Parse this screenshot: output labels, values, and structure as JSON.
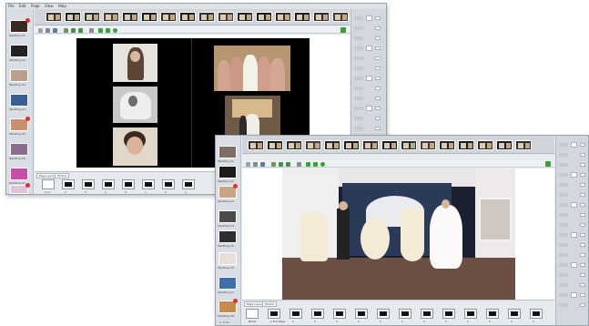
{
  "window1": {
    "menu": [
      "File",
      "Edit",
      "Page",
      "View",
      "Help"
    ],
    "sidebar_captions": [
      "Wedding 01",
      "Wedding 02",
      "Wedding 03",
      "Wedding 04",
      "Wedding 05",
      "Wedding 06",
      "Wedding 07",
      "Wedding 08"
    ],
    "template_count": 16,
    "tabs": [
      "Page Layouts",
      "Photos"
    ],
    "layout_captions": [
      "1+1",
      "2",
      "3",
      "1",
      "4",
      "1",
      "2",
      "1"
    ]
  },
  "window2": {
    "sidebar_captions": [
      "Wedding 01",
      "Wedding 02",
      "Wedding 03",
      "Wedding 04",
      "Wedding 05",
      "Wedding 06",
      "Wedding 07",
      "Wedding 08"
    ],
    "tabs": [
      "Page Layouts",
      "Photos"
    ],
    "layout_captions": [
      "Blank",
      "1 Full Page",
      "1",
      "1",
      "1",
      "1",
      "1",
      "1",
      "1",
      "1",
      "1",
      "1",
      "1",
      "1"
    ],
    "status": "1 of 20"
  },
  "colors": {
    "spread": "#000000",
    "panel": "#d2d8de",
    "badge": "#e0302b",
    "ok": "#3aa13a"
  },
  "icons": [
    "new-icon",
    "open-icon",
    "save-icon",
    "print-icon",
    "undo-icon",
    "redo-icon",
    "back-arrow-icon",
    "forward-arrow-icon",
    "refresh-icon"
  ]
}
